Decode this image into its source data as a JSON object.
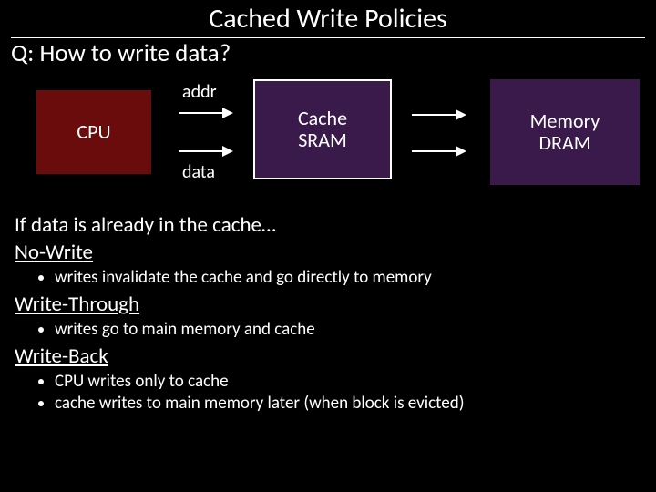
{
  "title": "Cached Write Policies",
  "question": "Q: How to write data?",
  "diagram": {
    "cpu": "CPU",
    "cache_top": "Cache",
    "cache_bot": "SRAM",
    "mem_top": "Memory",
    "mem_bot": "DRAM",
    "addr": "addr",
    "data": "data"
  },
  "lead": "If data is already in the cache…",
  "policies": {
    "nowrite": {
      "name": "No-Write",
      "b1": "writes invalidate the cache and go directly to memory"
    },
    "writethrough": {
      "name": "Write-Through",
      "b1": "writes go to main memory and cache"
    },
    "writeback": {
      "name": "Write-Back",
      "b1": "CPU writes only to cache",
      "b2": "cache writes to main memory later (when block is evicted)"
    }
  }
}
